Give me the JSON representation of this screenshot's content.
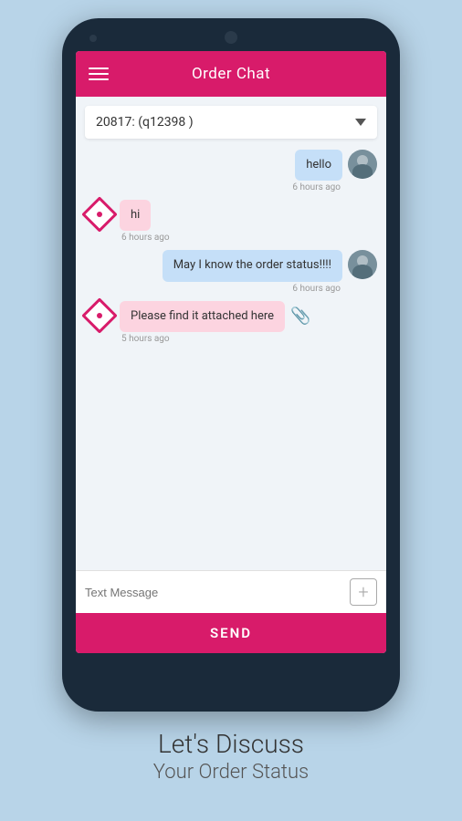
{
  "header": {
    "title": "Order Chat",
    "hamburger_label": "menu"
  },
  "dropdown": {
    "selected": "20817: (q12398 )",
    "arrow": "▼"
  },
  "messages": [
    {
      "id": 1,
      "side": "right",
      "text": "hello",
      "timestamp": "6 hours ago",
      "avatar_type": "person"
    },
    {
      "id": 2,
      "side": "left",
      "text": "hi",
      "timestamp": "6 hours ago",
      "avatar_type": "diamond"
    },
    {
      "id": 3,
      "side": "right",
      "text": "May I know the order status!!!!",
      "timestamp": "6 hours ago",
      "avatar_type": "person"
    },
    {
      "id": 4,
      "side": "left",
      "text": "Please find it attached here",
      "timestamp": "5 hours ago",
      "avatar_type": "diamond",
      "has_attachment": true
    }
  ],
  "input": {
    "placeholder": "Text Message",
    "plus_label": "+"
  },
  "send_button": {
    "label": "SEND"
  },
  "bottom": {
    "line1": "Let's Discuss",
    "line2": "Your Order Status"
  }
}
